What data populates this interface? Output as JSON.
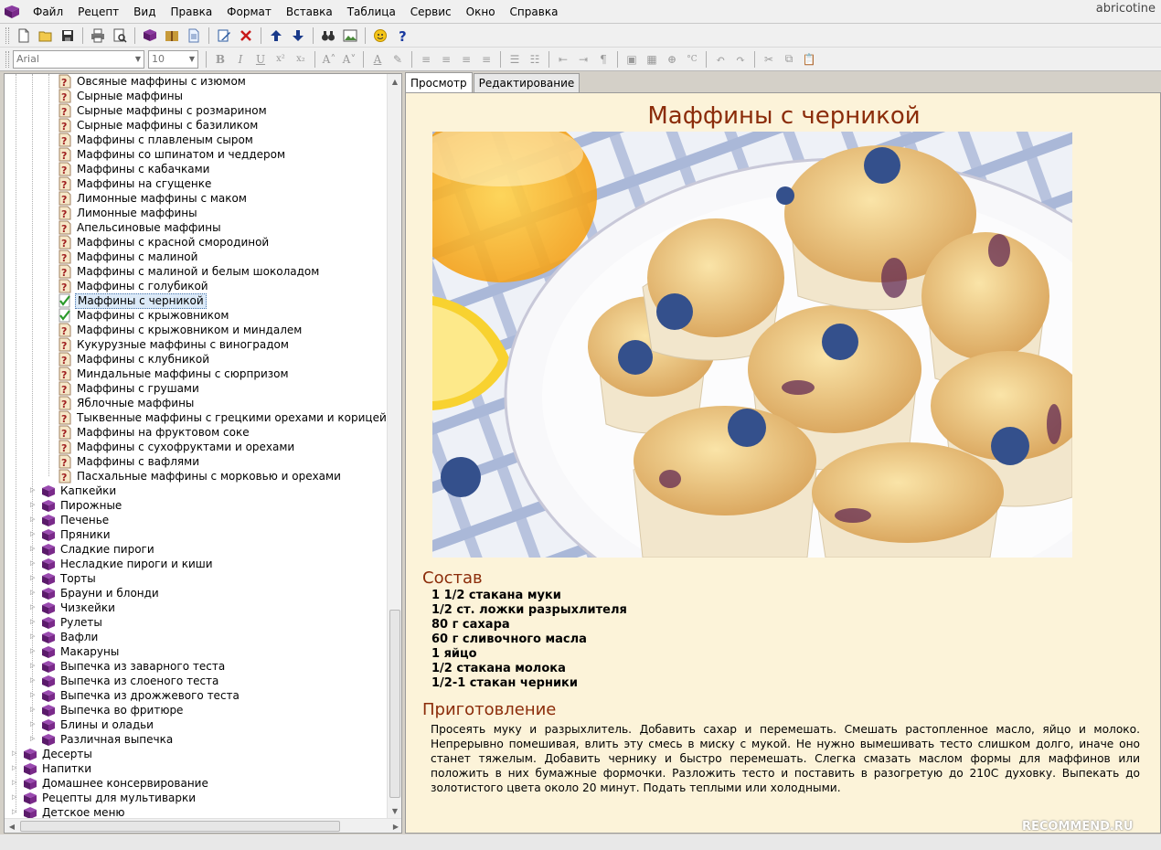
{
  "menu": [
    "Файл",
    "Рецепт",
    "Вид",
    "Правка",
    "Формат",
    "Вставка",
    "Таблица",
    "Сервис",
    "Окно",
    "Справка"
  ],
  "brand": "abricotine",
  "format_bar": {
    "font": "Arial",
    "size": "10"
  },
  "tabs": [
    "Просмотр",
    "Редактирование"
  ],
  "tree": {
    "muffins": [
      "Овсяные маффины с изюмом",
      "Сырные маффины",
      "Сырные маффины с розмарином",
      "Сырные маффины с базиликом",
      "Маффины с плавленым сыром",
      "Маффины со шпинатом и чеддером",
      "Маффины с кабачками",
      "Маффины на сгущенке",
      "Лимонные маффины с маком",
      "Лимонные маффины",
      "Апельсиновые маффины",
      "Маффины с красной смородиной",
      "Маффины с малиной",
      "Маффины с малиной и белым шоколадом",
      "Маффины с голубикой",
      "Маффины с черникой",
      "Маффины с крыжовником",
      "Маффины с крыжовником и миндалем",
      "Кукурузные маффины с виноградом",
      "Маффины с клубникой",
      "Миндальные маффины с сюрпризом",
      "Маффины с грушами",
      "Яблочные маффины",
      "Тыквенные маффины с грецкими орехами и корицей",
      "Маффины на фруктовом соке",
      "Маффины с сухофруктами и орехами",
      "Маффины с вафлями",
      "Пасхальные маффины с морковью и орехами"
    ],
    "muffins_selected_index": 15,
    "muffins_checked": [
      15,
      16
    ],
    "baking_categories": [
      "Капкейки",
      "Пирожные",
      "Печенье",
      "Пряники",
      "Сладкие пироги",
      "Несладкие пироги и киши",
      "Торты",
      "Брауни и блонди",
      "Чизкейки",
      "Рулеты",
      "Вафли",
      "Макаруны",
      "Выпечка из заварного теста",
      "Выпечка из слоеного теста",
      "Выпечка из дрожжевого теста",
      "Выпечка во фритюре",
      "Блины и оладьи",
      "Различная выпечка"
    ],
    "top_categories": [
      "Десерты",
      "Напитки",
      "Домашнее консервирование",
      "Рецепты для мультиварки",
      "Детское меню"
    ]
  },
  "recipe": {
    "title": "Маффины с черникой",
    "ingredients_heading": "Состав",
    "ingredients": [
      "1 1/2 стакана муки",
      "1/2 ст. ложки разрыхлителя",
      "80 г сахара",
      "60 г сливочного масла",
      "1 яйцо",
      "1/2 стакана молока",
      "1/2-1 стакан черники"
    ],
    "method_heading": "Приготовление",
    "method": "Просеять муку и разрыхлитель. Добавить сахар и перемешать. Смешать растопленное масло, яйцо и молоко. Непрерывно помешивая, влить эту смесь в миску с мукой. Не нужно вымешивать тесто слишком долго, иначе оно станет тяжелым. Добавить чернику и быстро перемешать. Слегка смазать маслом формы для маффинов или положить в них бумажные формочки. Разложить тесто и поставить в разогретую до 210С духовку. Выпекать до золотистого цвета около 20 минут. Подать теплыми или холодными."
  },
  "watermark": "RECOMMEND.RU",
  "colors": {
    "heading": "#8b2c0a",
    "content_bg": "#fcf3d9",
    "book_icon": "#6a1f7a"
  }
}
